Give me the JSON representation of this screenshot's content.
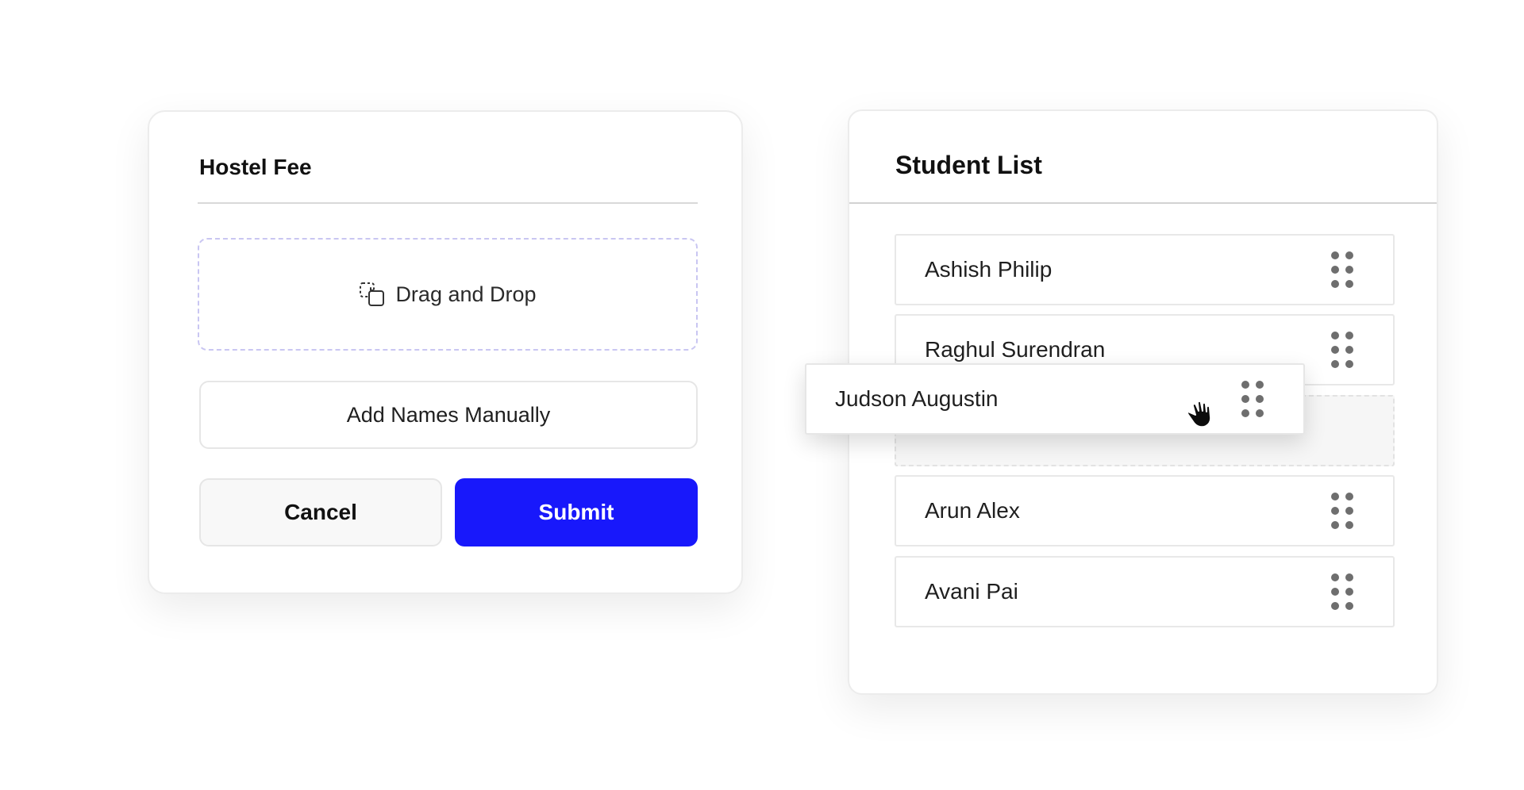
{
  "fee_card": {
    "title": "Hostel Fee",
    "dropzone": {
      "icon": "drag-drop-icon",
      "label": "Drag and Drop"
    },
    "manual_button": "Add Names Manually",
    "cancel_button": "Cancel",
    "submit_button": "Submit",
    "accent_color": "#1818fb"
  },
  "student_list": {
    "title": "Student List",
    "students": [
      {
        "name": "Ashish Philip"
      },
      {
        "name": "Raghul Surendran"
      },
      {
        "name": "Arun Alex"
      },
      {
        "name": "Avani Pai"
      }
    ],
    "dragging": {
      "name": "Judson Augustin"
    },
    "handle_icon": "drag-handle-icon",
    "cursor_icon": "grab-hand-icon"
  }
}
